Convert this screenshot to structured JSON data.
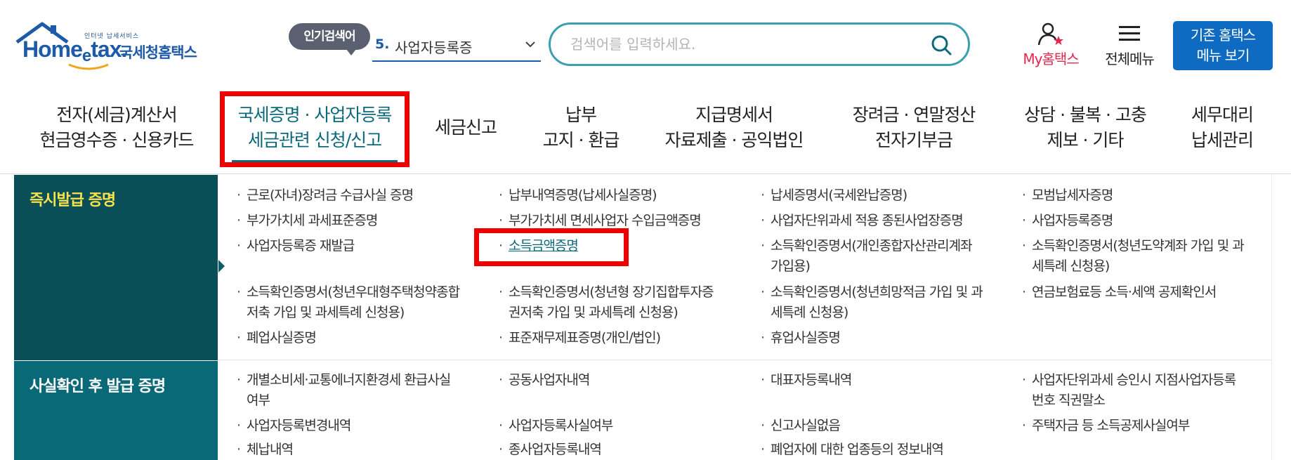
{
  "header": {
    "logo_small": "인터넷 납세서비스",
    "logo_en": "Home",
    "logo_en_e": "e",
    "logo_en_tax": "tax.",
    "logo_ko": "국세청홈택스",
    "popular_label": "인기검색어",
    "popular_rank": "5.",
    "popular_term": "사업자등록증",
    "search_placeholder": "검색어를 입력하세요.",
    "my_hometax": "My홈택스",
    "all_menu": "전체메뉴",
    "classic_line1": "기존 홈택스",
    "classic_line2": "메뉴 보기"
  },
  "nav": [
    {
      "line1": "전자(세금)계산서",
      "line2": "현금영수증 · 신용카드"
    },
    {
      "line1": "국세증명 · 사업자등록",
      "line2": "세금관련 신청/신고"
    },
    {
      "line1": "세금신고",
      "line2": ""
    },
    {
      "line1": "납부",
      "line2": "고지 · 환급"
    },
    {
      "line1": "지급명세서",
      "line2": "자료제출 · 공익법인"
    },
    {
      "line1": "장려금 · 연말정산",
      "line2": "전자기부금"
    },
    {
      "line1": "상담 · 불복 · 고충",
      "line2": "제보 · 기타"
    },
    {
      "line1": "세무대리",
      "line2": "납세관리"
    }
  ],
  "sections": [
    {
      "title": "즉시발급 증명",
      "links": [
        "근로(자녀)장려금 수급사실 증명",
        "납부내역증명(납세사실증명)",
        "납세증명서(국세완납증명)",
        "모범납세자증명",
        "부가가치세 과세표준증명",
        "부가가치세 면세사업자 수입금액증명",
        "사업자단위과세 적용 종된사업장증명",
        "사업자등록증명",
        "사업자등록증 재발급",
        "소득금액증명",
        "소득확인증명서(개인종합자산관리계좌",
        "가입용)",
        "소득확인증명서(청년도약계좌 가입 및 과",
        "세특례 신청용)",
        "소득확인증명서(청년우대형주택청약종합",
        "저축 가입 및 과세특례 신청용)",
        "소득확인증명서(청년형 장기집합투자증",
        "권저축 가입 및 과세특례 신청용)",
        "소득확인증명서(청년희망적금 가입 및 과",
        "세특례 신청용)",
        "연금보험료등 소득·세액 공제확인서",
        "폐업사실증명",
        "표준재무제표증명(개인/법인)",
        "휴업사실증명"
      ]
    },
    {
      "title": "사실확인 후 발급 증명",
      "links": [
        "개별소비세·교통에너지환경세 환급사실",
        "여부",
        "공동사업자내역",
        "대표자등록내역",
        "사업자단위과세 승인시 지점사업자등록",
        "번호 직권말소",
        "사업자등록변경내역",
        "사업자등록사실여부",
        "신고사실없음",
        "주택자금 등 소득공제사실여부",
        "체납내역",
        "종사업자등록내역",
        "폐업자에 대한 업종등의 정보내역"
      ]
    }
  ],
  "colors": {
    "brand_blue": "#1d5aa8",
    "accent_teal": "#0b6a7a",
    "highlight_red": "#ee0000",
    "section_yellow": "#f6e24a"
  }
}
